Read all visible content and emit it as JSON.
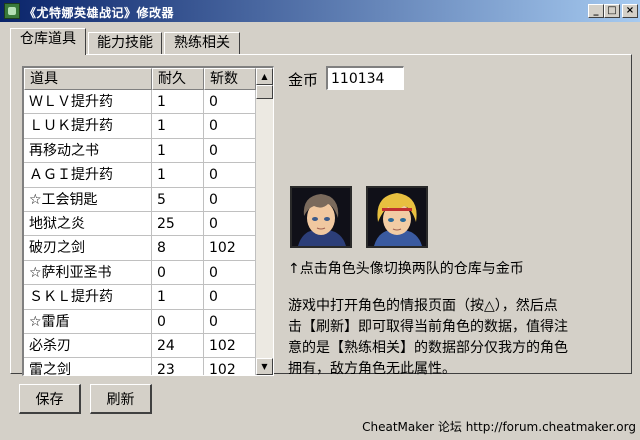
{
  "window": {
    "title": "《尤特娜英雄战记》修改器",
    "minimize_glyph": "_",
    "maximize_glyph": "□",
    "close_glyph": "×"
  },
  "tabs": [
    {
      "label": "仓库道具",
      "active": true
    },
    {
      "label": "能力技能",
      "active": false
    },
    {
      "label": "熟练相关",
      "active": false
    }
  ],
  "item_list": {
    "columns": [
      "道具",
      "耐久",
      "斩数"
    ],
    "rows": [
      [
        "ＷＬＶ提升药",
        "1",
        "0"
      ],
      [
        "ＬＵＫ提升药",
        "1",
        "0"
      ],
      [
        "再移动之书",
        "1",
        "0"
      ],
      [
        "ＡＧＩ提升药",
        "1",
        "0"
      ],
      [
        "☆工会钥匙",
        "5",
        "0"
      ],
      [
        "地狱之炎",
        "25",
        "0"
      ],
      [
        "破刃之剑",
        "8",
        "102"
      ],
      [
        "☆萨利亚圣书",
        "0",
        "0"
      ],
      [
        "ＳＫＬ提升药",
        "1",
        "0"
      ],
      [
        "☆雷盾",
        "0",
        "0"
      ],
      [
        "必杀刃",
        "24",
        "102"
      ],
      [
        "雷之剑",
        "23",
        "102"
      ]
    ],
    "scroll_up_glyph": "▲",
    "scroll_down_glyph": "▼"
  },
  "gold": {
    "label": "金币",
    "value": "110134"
  },
  "portraits": [
    {
      "name": "party-1-portrait",
      "hair": "#7a6a5c"
    },
    {
      "name": "party-2-portrait",
      "hair": "#e8c040"
    }
  ],
  "hint": "↑点击角色头像切换两队的仓库与金币",
  "description": [
    "游戏中打开角色的情报页面（按△），然后点",
    "击【刷新】即可取得当前角色的数据，值得注",
    "意的是【熟练相关】的数据部分仅我方的角色",
    "拥有，敌方角色无此属性。"
  ],
  "buttons": {
    "save": "保存",
    "refresh": "刷新"
  },
  "footer": "CheatMaker 论坛 http://forum.cheatmaker.org"
}
